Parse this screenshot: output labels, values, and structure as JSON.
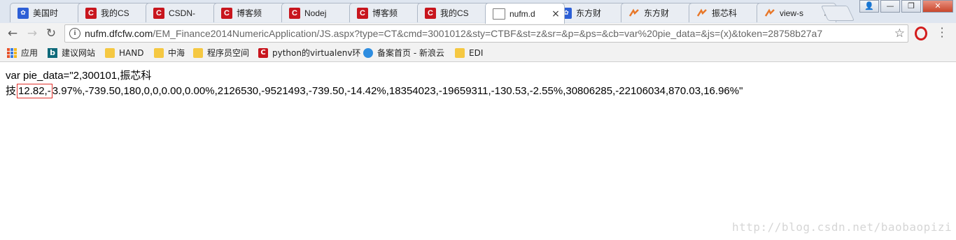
{
  "tabs": [
    {
      "title": "美国时",
      "favicon": "baidu-paw-icon"
    },
    {
      "title": "我的CS",
      "favicon": "csdn-icon"
    },
    {
      "title": "CSDN-",
      "favicon": "csdn-icon"
    },
    {
      "title": "博客频",
      "favicon": "csdn-icon"
    },
    {
      "title": "Nodej",
      "favicon": "csdn-icon"
    },
    {
      "title": "博客频",
      "favicon": "csdn-icon"
    },
    {
      "title": "我的CS",
      "favicon": "csdn-icon"
    },
    {
      "title": "nufm.d",
      "favicon": "document-icon"
    },
    {
      "title": "东方财",
      "favicon": "baidu-paw-icon"
    },
    {
      "title": "东方财",
      "favicon": "eastmoney-icon"
    },
    {
      "title": "振芯科",
      "favicon": "eastmoney-icon"
    },
    {
      "title": "view-s",
      "favicon": "eastmoney-icon"
    }
  ],
  "address": {
    "host": "nufm.dfcfw.com",
    "path": "/EM_Finance2014NumericApplication/JS.aspx?type=CT&cmd=3001012&sty=CTBF&st=z&sr=&p=&ps=&cb=var%20pie_data=&js=(x)&token=28758b27a7"
  },
  "bookmarks": [
    {
      "label": "应用",
      "icon": "apps-grid-icon"
    },
    {
      "label": "建议网站",
      "icon": "bing-icon"
    },
    {
      "label": "HAND",
      "icon": "folder-icon"
    },
    {
      "label": "中海",
      "icon": "folder-icon"
    },
    {
      "label": "程序员空间",
      "icon": "folder-icon"
    },
    {
      "label": "python的virtualenv环",
      "icon": "csdn-icon"
    },
    {
      "label": "备案首页 - 新浪云",
      "icon": "cloud-icon"
    },
    {
      "label": "EDI",
      "icon": "folder-icon"
    }
  ],
  "content": {
    "line1": "var pie_data=\"2,300101,振芯科",
    "line2_prefix": "技",
    "line2_highlight": "12.82,-",
    "line2_rest": "3.97%,-739.50,180,0,0,0.00,0.00%,2126530,-9521493,-739.50,-14.42%,18354023,-19659311,-130.53,-2.55%,30806285,-22106034,870.03,16.96%\""
  },
  "watermark": "http://blog.csdn.net/baobaopizi",
  "colors": {
    "highlight_border": "#e0302a",
    "csdn_red": "#c8161e"
  }
}
